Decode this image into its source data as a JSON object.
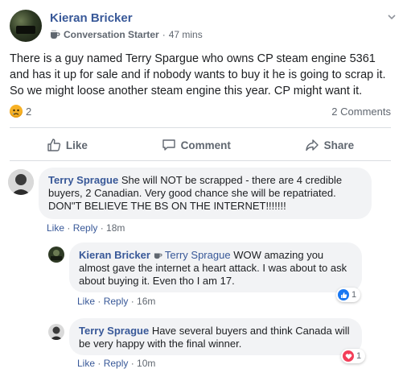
{
  "post": {
    "author": "Kieran Bricker",
    "badge": "Conversation Starter",
    "separator": "·",
    "time": "47 mins",
    "text": "There is a guy named Terry Spargue who owns CP steam engine 5361 and has it up for sale and if nobody wants to buy it he is going to scrap it. So we might loose another steam engine this year. CP might want it.",
    "reaction_count": "2",
    "comments_count": "2 Comments"
  },
  "actions": {
    "like": "Like",
    "comment": "Comment",
    "share": "Share"
  },
  "comments": [
    {
      "author": "Terry Sprague",
      "text": "She will NOT be scrapped - there are 4 credible buyers, 2 Canadian. Very good chance she will be repatriated. DON\"T BELIEVE THE BS ON THE INTERNET!!!!!!!",
      "like": "Like",
      "reply": "Reply",
      "time": "18m"
    },
    {
      "author": "Kieran Bricker",
      "mention": "Terry Sprague",
      "text": "WOW amazing you almost gave the internet a heart attack. I was about to ask about buying it. Even tho I am 17.",
      "like": "Like",
      "reply": "Reply",
      "time": "16m",
      "reaction_count": "1"
    },
    {
      "author": "Terry Sprague",
      "text": "Have several buyers and think Canada will be very happy with the final winner.",
      "like": "Like",
      "reply": "Reply",
      "time": "10m",
      "reaction_count": "1"
    }
  ],
  "colors": {
    "link": "#385898",
    "muted": "#606770",
    "bubble": "#f2f3f5",
    "like_blue": "#1877f2",
    "love_red": "#f33e58"
  }
}
